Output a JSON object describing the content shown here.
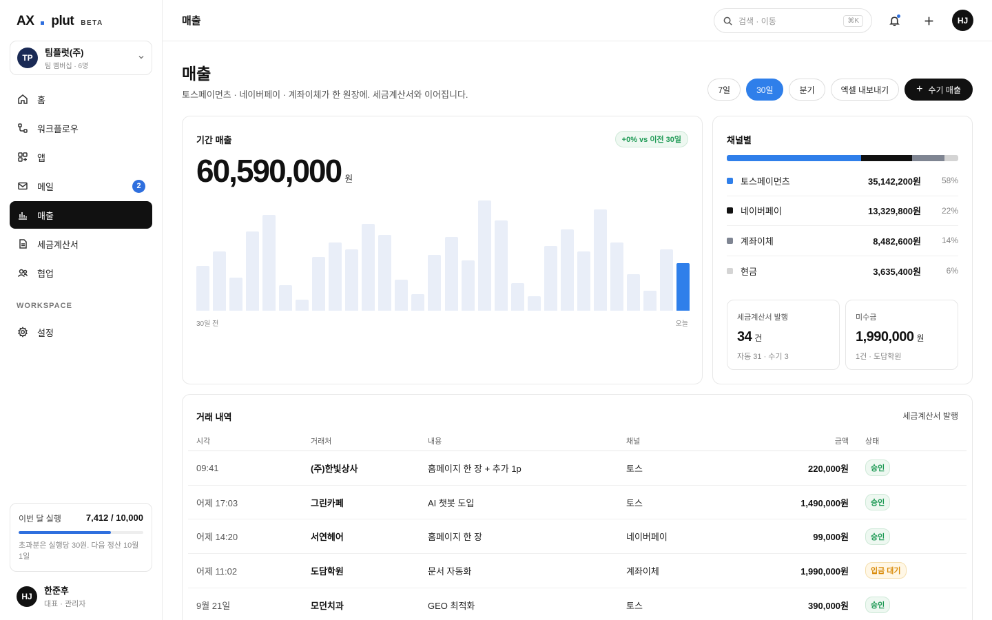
{
  "brand": {
    "left": "AX",
    "right": "plut",
    "tag": "BETA",
    "accent": "#2f6fde"
  },
  "org": {
    "initials": "TP",
    "name": "팀플럿(주)",
    "sub": "팀 멤버십 · 6명"
  },
  "nav": [
    {
      "label": "홈",
      "icon": "home-icon"
    },
    {
      "label": "워크플로우",
      "icon": "workflow-icon"
    },
    {
      "label": "앱",
      "icon": "apps-icon"
    },
    {
      "label": "메일",
      "icon": "mail-icon",
      "count": "2"
    },
    {
      "label": "매출",
      "icon": "chart-icon",
      "active": true
    },
    {
      "label": "세금계산서",
      "icon": "document-icon"
    },
    {
      "label": "협업",
      "icon": "users-icon"
    }
  ],
  "workspace": {
    "label": "WORKSPACE",
    "settings": "설정"
  },
  "usage": {
    "label": "이번 달 실행",
    "value": "7,412 / 10,000",
    "progress": 0.7412,
    "note": "초과분은 실행당 30원. 다음 정산 10월 1일"
  },
  "user": {
    "initials": "HJ",
    "name": "한준후",
    "role": "대표 · 관리자"
  },
  "topbar": {
    "crumb": "매출",
    "search_placeholder": "검색 · 이동",
    "search_kbd": "⌘K",
    "avatar": "HJ"
  },
  "header": {
    "title": "매출",
    "subtitle": "토스페이먼츠 · 네이버페이 · 계좌이체가 한 원장에. 세금계산서와 이어집니다."
  },
  "filters": {
    "d7": "7일",
    "d30": "30일",
    "quarter": "분기",
    "export": "엑셀 내보내기",
    "add": "수기 매출"
  },
  "revenue": {
    "title": "기간 매출",
    "delta": "+0% vs 이전 30일",
    "amount": "60,590,000",
    "unit": "원",
    "x_start": "30일 전",
    "x_end": "오늘"
  },
  "chart_data": {
    "type": "bar",
    "title": "기간 매출",
    "values": [
      40,
      53,
      30,
      71,
      86,
      23,
      10,
      48,
      61,
      55,
      78,
      68,
      28,
      15,
      50,
      66,
      45,
      99,
      81,
      25,
      13,
      58,
      73,
      53,
      91,
      61,
      33,
      18,
      55,
      43
    ],
    "highlight_last": true,
    "colors": {
      "bar": "#e9eef8",
      "today": "#2f7fea"
    }
  },
  "channels": {
    "title": "채널별",
    "items": [
      {
        "name": "토스페이먼츠",
        "value": "35,142,200원",
        "pct": "58%",
        "share": 58,
        "color": "#2f7fea"
      },
      {
        "name": "네이버페이",
        "value": "13,329,800원",
        "pct": "22%",
        "share": 22,
        "color": "#111111"
      },
      {
        "name": "계좌이체",
        "value": "8,482,600원",
        "pct": "14%",
        "share": 14,
        "color": "#7f8592"
      },
      {
        "name": "현금",
        "value": "3,635,400원",
        "pct": "6%",
        "share": 6,
        "color": "#d4d4d4"
      }
    ]
  },
  "tax": {
    "label": "세금계산서 발행",
    "value": "34",
    "unit": "건",
    "sub": "자동 31 · 수기 3"
  },
  "receivable": {
    "label": "미수금",
    "value": "1,990,000",
    "unit": "원",
    "sub": "1건 · 도담학원"
  },
  "transactions": {
    "title": "거래 내역",
    "link": "세금계산서 발행",
    "headers": {
      "time": "시각",
      "client": "거래처",
      "desc": "내용",
      "channel": "채널",
      "amount": "금액",
      "status": "상태"
    },
    "rows": [
      {
        "time": "09:41",
        "client": "(주)한빛상사",
        "desc": "홈페이지 한 장 + 추가 1p",
        "channel": "토스",
        "amount": "220,000원",
        "status": "승인",
        "kind": "ok"
      },
      {
        "time": "어제 17:03",
        "client": "그린카페",
        "desc": "AI 챗봇 도입",
        "channel": "토스",
        "amount": "1,490,000원",
        "status": "승인",
        "kind": "ok"
      },
      {
        "time": "어제 14:20",
        "client": "서연헤어",
        "desc": "홈페이지 한 장",
        "channel": "네이버페이",
        "amount": "99,000원",
        "status": "승인",
        "kind": "ok"
      },
      {
        "time": "어제 11:02",
        "client": "도담학원",
        "desc": "문서 자동화",
        "channel": "계좌이체",
        "amount": "1,990,000원",
        "status": "입금 대기",
        "kind": "wait"
      },
      {
        "time": "9월 21일",
        "client": "모던치과",
        "desc": "GEO 최적화",
        "channel": "토스",
        "amount": "390,000원",
        "status": "승인",
        "kind": "ok"
      }
    ]
  }
}
